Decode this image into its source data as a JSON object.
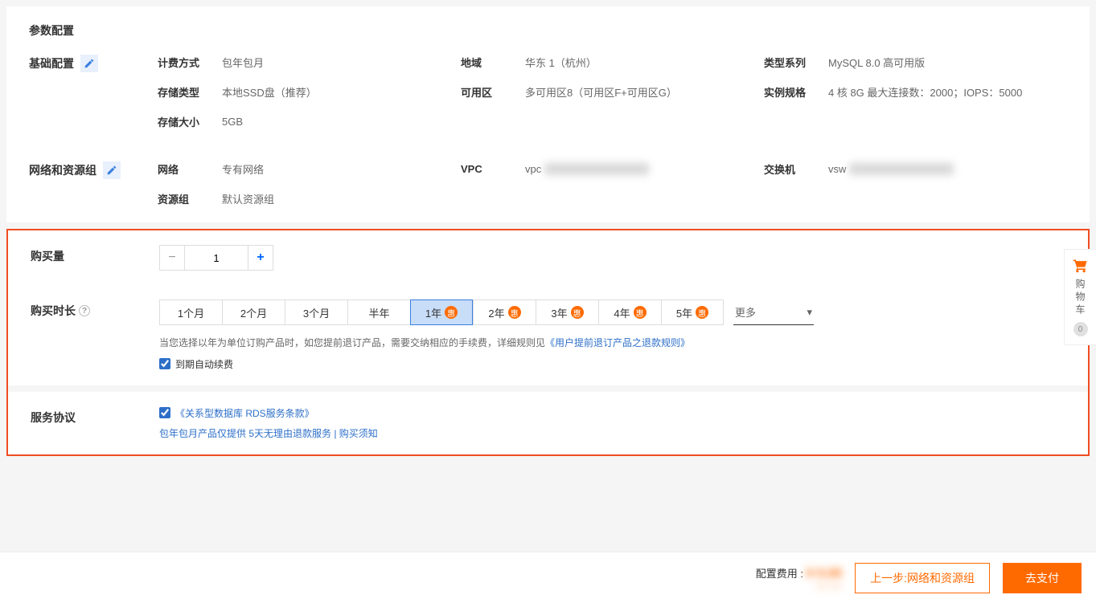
{
  "pageTitle": "参数配置",
  "sections": {
    "basic": {
      "title": "基础配置",
      "items": {
        "billing": {
          "k": "计费方式",
          "v": "包年包月"
        },
        "region": {
          "k": "地域",
          "v": "华东 1（杭州）"
        },
        "series": {
          "k": "类型系列",
          "v": "MySQL 8.0 高可用版"
        },
        "storageType": {
          "k": "存储类型",
          "v": "本地SSD盘（推荐）"
        },
        "zone": {
          "k": "可用区",
          "v": "多可用区8（可用区F+可用区G）"
        },
        "spec": {
          "k": "实例规格",
          "v": "4 核 8G 最大连接数：2000；IOPS：5000"
        },
        "storageSize": {
          "k": "存储大小",
          "v": "5GB"
        }
      }
    },
    "network": {
      "title": "网络和资源组",
      "items": {
        "net": {
          "k": "网络",
          "v": "专有网络"
        },
        "vpc": {
          "k": "VPC",
          "prefix": "vpc"
        },
        "vswitch": {
          "k": "交换机",
          "prefix": "vsw"
        },
        "resGroup": {
          "k": "资源组",
          "v": "默认资源组"
        }
      }
    }
  },
  "purchase": {
    "qtyLabel": "购买量",
    "qty": "1",
    "durationLabel": "购买时长",
    "opts": [
      "1个月",
      "2个月",
      "3个月",
      "半年",
      "1年",
      "2年",
      "3年",
      "4年",
      "5年"
    ],
    "selectedIdx": 4,
    "discountLabel": "惠",
    "more": "更多",
    "noteA": "当您选择以年为单位订购产品时，如您提前退订产品，需要交纳相应的手续费，详细规则见",
    "noteLink": "《用户提前退订产品之退款规则》",
    "autoRenew": "到期自动续费"
  },
  "agreement": {
    "label": "服务协议",
    "termsLink": "《关系型数据库 RDS服务条款》",
    "subNoteA": "包年包月产品仅提供 5天无理由退款服务 | ",
    "subLink": "购买须知"
  },
  "cart": {
    "label": "购物车",
    "count": "0"
  },
  "footer": {
    "feeLabel": "配置费用 :",
    "prevBtn": "上一步:网络和资源组",
    "payBtn": "去支付"
  }
}
